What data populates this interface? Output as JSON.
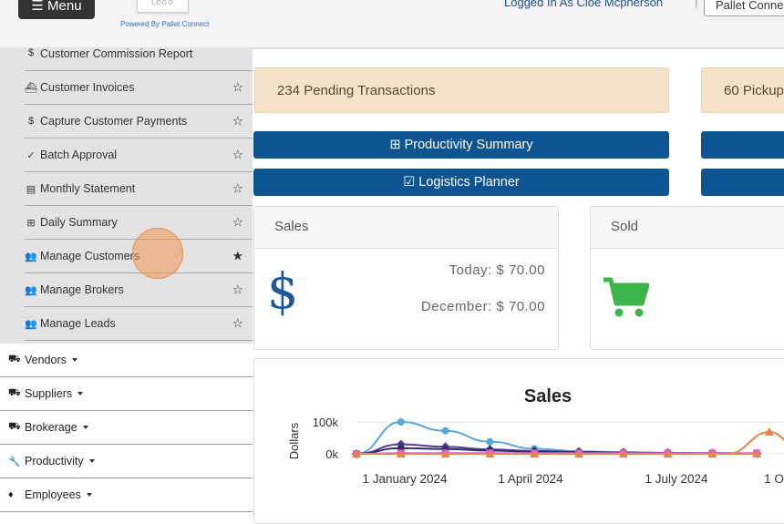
{
  "header": {
    "menu_label": "Menu",
    "logo_text": "LOGO",
    "powered_by": "Powered By Pallet Connect",
    "logged_in": "Logged In As Cloe Mcpherson",
    "separator": "|",
    "company_button": "Pallet Conne"
  },
  "sidebar": {
    "sub_items": [
      {
        "label": "Customer Commission Report",
        "glyph": "$",
        "starred": null
      },
      {
        "label": "Customer Invoices",
        "glyph": "⛴",
        "starred": false
      },
      {
        "label": "Capture Customer Payments",
        "glyph": "$",
        "starred": false
      },
      {
        "label": "Batch Approval",
        "glyph": "✓",
        "starred": false
      },
      {
        "label": "Monthly Statement",
        "glyph": "▤",
        "starred": false
      },
      {
        "label": "Daily Summary",
        "glyph": "⊞",
        "starred": false
      },
      {
        "label": "Manage Customers",
        "glyph": "👥",
        "starred": true
      },
      {
        "label": "Manage Brokers",
        "glyph": "👥",
        "starred": false
      },
      {
        "label": "Manage Leads",
        "glyph": "👥",
        "starred": false
      }
    ],
    "main_items": [
      {
        "label": "Vendors",
        "glyph": "⛟"
      },
      {
        "label": "Suppliers",
        "glyph": "⛟"
      },
      {
        "label": "Brokerage",
        "glyph": "⛟"
      },
      {
        "label": "Productivity",
        "glyph": "🔧"
      },
      {
        "label": "Employees",
        "glyph": "♦"
      }
    ]
  },
  "alerts": {
    "pending": "234 Pending Transactions",
    "pickup": "60 Pickup"
  },
  "buttons": {
    "productivity_summary": "⊞ Productivity Summary",
    "logistics_planner": "☑ Logistics Planner"
  },
  "sales_card": {
    "title": "Sales",
    "icon": "$",
    "today": "Today: $ 70.00",
    "month": "December: $ 70.00"
  },
  "sold_card": {
    "title": "Sold",
    "icon": "cart-icon"
  },
  "colors": {
    "brand_blue": "#0e5490",
    "alert_bg": "#f6e2c7",
    "cart_green": "#3eb549"
  },
  "chart_data": {
    "type": "line",
    "title": "Sales",
    "ylabel": "Dollars",
    "y_ticks": [
      "100k",
      "0k"
    ],
    "x_ticks": [
      "1 January 2024",
      "1 April 2024",
      "1 July 2024",
      "1 O"
    ],
    "ylim": [
      0,
      120000
    ],
    "x": [
      0,
      1,
      2,
      3,
      4,
      5,
      6,
      7,
      8,
      9
    ],
    "series": [
      {
        "color": "#5aa5dc",
        "marker": "circle",
        "values": [
          0,
          100000,
          72000,
          38000,
          16000,
          8000,
          5000,
          3000,
          2000,
          1000
        ]
      },
      {
        "color": "#5b3f8c",
        "marker": "diamond",
        "values": [
          0,
          30000,
          22000,
          14000,
          9000,
          6000,
          4000,
          3000,
          2000,
          1000
        ]
      },
      {
        "color": "#2c2c6e",
        "marker": "diamond",
        "values": [
          0,
          18000,
          15000,
          10000,
          7000,
          5000,
          3500,
          2500,
          1500,
          1000
        ]
      },
      {
        "color": "#c863d6",
        "marker": "square",
        "values": [
          0,
          2000,
          2000,
          2000,
          2000,
          2000,
          2000,
          2000,
          2000,
          2000
        ]
      },
      {
        "color": "#e6834a",
        "marker": "triangle",
        "values": [
          0,
          0,
          0,
          0,
          0,
          0,
          0,
          0,
          0,
          0
        ]
      }
    ]
  }
}
